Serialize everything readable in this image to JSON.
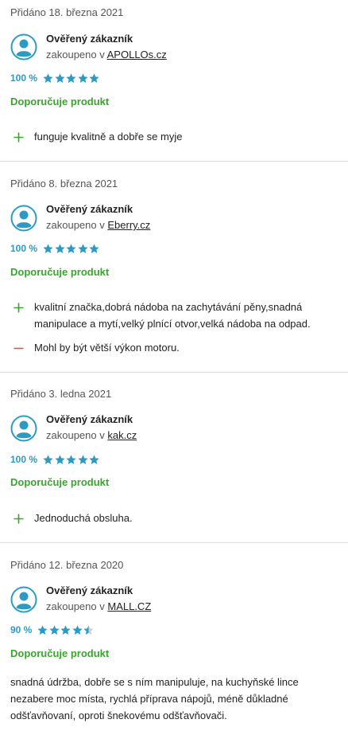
{
  "colors": {
    "accent_blue": "#2b9bc4",
    "recommend_green": "#3aa52e",
    "con_red": "#d9534f",
    "divider": "#dcdcdc"
  },
  "reviews": [
    {
      "date": "Přidáno 18. března 2021",
      "author": "Ověřený zákazník",
      "shop_prefix": "zakoupeno v",
      "shop_name": "APOLLOs.cz",
      "rating_label": "100 %",
      "rating_stars": 5,
      "recommend": "Doporučuje produkt",
      "pros": [
        "funguje kvalitně a dobře se myje"
      ],
      "cons": []
    },
    {
      "date": "Přidáno 8. března 2021",
      "author": "Ověřený zákazník",
      "shop_prefix": "zakoupeno v",
      "shop_name": "Eberry.cz",
      "rating_label": "100 %",
      "rating_stars": 5,
      "recommend": "Doporučuje produkt",
      "pros": [
        "kvalitní značka,dobrá nádoba na zachytávání pěny,snadná manipulace a mytí,velký plnící otvor,velká nádoba na odpad."
      ],
      "cons": [
        "Mohl by být větší výkon motoru."
      ]
    },
    {
      "date": "Přidáno 3. ledna 2021",
      "author": "Ověřený zákazník",
      "shop_prefix": "zakoupeno v",
      "shop_name": "kak.cz",
      "rating_label": "100 %",
      "rating_stars": 5,
      "recommend": "Doporučuje produkt",
      "pros": [
        "Jednoduchá obsluha."
      ],
      "cons": []
    },
    {
      "date": "Přidáno 12. března 2020",
      "author": "Ověřený zákazník",
      "shop_prefix": "zakoupeno v",
      "shop_name": "MALL.CZ",
      "rating_label": "90 %",
      "rating_stars": 4.5,
      "recommend": "Doporučuje produkt",
      "text": "snadná údržba, dobře se s ním manipuluje, na kuchyňské lince nezabere moc místa, rychlá příprava nápojů, méně důkladné odšťavňovaní, oproti šnekovému odšťavňovači."
    }
  ]
}
